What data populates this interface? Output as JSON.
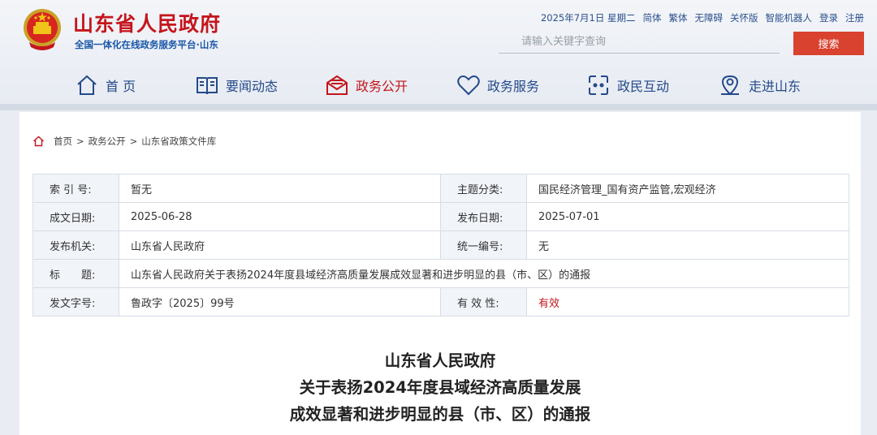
{
  "site": {
    "title": "山东省人民政府",
    "subtitle": "全国一体化在线政务服务平台·山东"
  },
  "toplinks": [
    "2025年7月1日 星期二",
    "简体",
    "繁体",
    "无障碍",
    "关怀版",
    "智能机器人",
    "登录",
    "注册"
  ],
  "search": {
    "placeholder": "请输入关键字查询",
    "button": "搜索"
  },
  "nav": [
    {
      "label": "首 页",
      "icon": "home-icon"
    },
    {
      "label": "要闻动态",
      "icon": "news-book-icon"
    },
    {
      "label": "政务公开",
      "icon": "mail-open-icon",
      "active": true
    },
    {
      "label": "政务服务",
      "icon": "heart-icon"
    },
    {
      "label": "政民互动",
      "icon": "chat-link-icon"
    },
    {
      "label": "走进山东",
      "icon": "location-pin-icon"
    }
  ],
  "breadcrumb": [
    "首页",
    ">",
    "政务公开",
    ">",
    "山东省政策文件库"
  ],
  "meta": {
    "index_label": "索 引 号:",
    "index_value": "暂无",
    "topic_label": "主题分类:",
    "topic_value": "国民经济管理_国有资产监管,宏观经济",
    "written_label": "成文日期:",
    "written_value": "2025-06-28",
    "published_label": "发布日期:",
    "published_value": "2025-07-01",
    "org_label": "发布机关:",
    "org_value": "山东省人民政府",
    "unified_label": "统一编号:",
    "unified_value": "无",
    "title_label": "标　　题:",
    "title_value": "山东省人民政府关于表扬2024年度县域经济高质量发展成效显著和进步明显的县（市、区）的通报",
    "docno_label": "发文字号:",
    "docno_value": "鲁政字〔2025〕99号",
    "validity_label": "有 效 性:",
    "validity_value": "有效"
  },
  "document": {
    "line1": "山东省人民政府",
    "line2": "关于表扬2024年度县域经济高质量发展",
    "line3": "成效显著和进步明显的县（市、区）的通报"
  },
  "colors": {
    "brand_red": "#c4161c",
    "nav_blue": "#244a8a",
    "search_button": "#d9422e"
  }
}
